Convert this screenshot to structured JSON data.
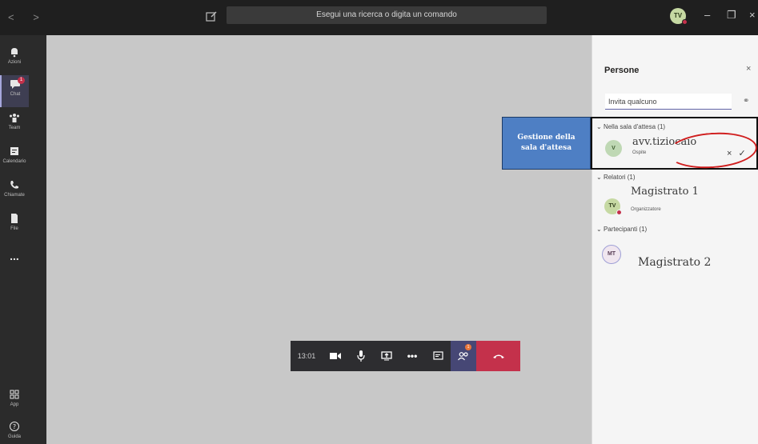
{
  "titlebar": {
    "search_placeholder": "Esegui una ricerca o digita un comando",
    "avatar_initials": "TV",
    "nav": "< >"
  },
  "rail": {
    "items": [
      {
        "label": "Azioni",
        "icon": "bell-icon"
      },
      {
        "label": "Chat",
        "icon": "chat-icon",
        "badge": "1"
      },
      {
        "label": "Team",
        "icon": "team-icon"
      },
      {
        "label": "Calendario",
        "icon": "calendar-icon"
      },
      {
        "label": "Chiamate",
        "icon": "phone-icon"
      },
      {
        "label": "File",
        "icon": "file-icon"
      },
      {
        "label": "...",
        "icon": "more-icon"
      }
    ],
    "bottom": [
      {
        "label": "App",
        "icon": "apps-icon"
      },
      {
        "label": "Guida",
        "icon": "help-icon"
      }
    ]
  },
  "callbar": {
    "timer": "13:01",
    "people_badge": "1"
  },
  "panel": {
    "title": "Persone",
    "invite_placeholder": "Invita qualcuno",
    "lobby_header": "Nella sala d'attesa (1)",
    "lobby_person": {
      "initials": "V",
      "name": "avv.tiziocaio",
      "role": "Ospite"
    },
    "presenters_header": "Relatori (1)",
    "presenter": {
      "initials": "TV",
      "name": "Magistrato 1",
      "role": "Organizzatore"
    },
    "attendees_header": "Partecipanti (1)",
    "attendee": {
      "initials": "MT",
      "name": "Magistrato 2"
    }
  },
  "callout": {
    "text": "Gestione della sala d'attesa"
  },
  "colors": {
    "accent": "#6264a7",
    "hangup": "#c4314b",
    "callout_blue": "#4e7fc4",
    "annotation_red": "#d01e1e"
  }
}
